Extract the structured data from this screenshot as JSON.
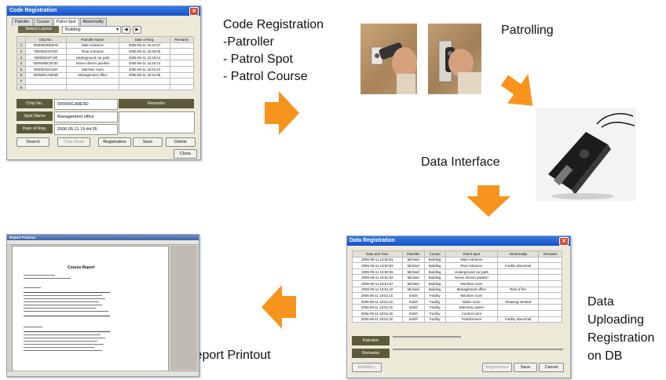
{
  "flow": {
    "step1": {
      "title": "Code Registration",
      "items": [
        "-Patroller",
        "- Patrol Spot",
        "- Patrol Course"
      ]
    },
    "step2": {
      "label": "Patrolling"
    },
    "step3": {
      "label": "Data Interface"
    },
    "step4": {
      "lines": [
        "Data",
        "Uploading",
        "Registration",
        "on DB"
      ]
    },
    "step5": {
      "label": "Report Printout"
    }
  },
  "colors": {
    "arrow": "#f7941d",
    "olive_button": "#5c5a3a",
    "titlebar": "#1f5fd6"
  },
  "code_window": {
    "title": "Code Registration",
    "tabs": [
      "Patroller",
      "Course",
      "Patrol Spot",
      "Abnormality"
    ],
    "select_button": "Select Layout",
    "select_value": "Building",
    "columns": [
      "Chip No.",
      "Patroller Name",
      "Date of Reg.",
      "Remarks"
    ],
    "rows": [
      {
        "n": "1",
        "chip": "0000002DE9A8",
        "name": "Main entrance",
        "date": "2006-05-11 15:44:57"
      },
      {
        "n": "2",
        "chip": "00000024CF50",
        "name": "Rear entrance",
        "date": "2006-05-11 15:45:05"
      },
      {
        "n": "3",
        "chip": "00000024F72E",
        "name": "Underground car park",
        "date": "2006-05-11 15:46:01"
      },
      {
        "n": "4",
        "chip": "000000BC9C0C",
        "name": "Seven drivers pavilion",
        "date": "2006-05-11 15:46:12"
      },
      {
        "n": "5",
        "chip": "00000022A1DF",
        "name": "Machine room",
        "date": "2006-05-11 15:44:24"
      },
      {
        "n": "6",
        "chip": "000000CA8E5D",
        "name": "Management office",
        "date": "2006-05-11 15:44:35"
      },
      {
        "n": "7",
        "chip": "",
        "name": "",
        "date": ""
      },
      {
        "n": "8",
        "chip": "",
        "name": "",
        "date": ""
      }
    ],
    "chip_label": "Chip No.",
    "chip_value": "000000CA8E5D",
    "remarks_label": "Remarks",
    "spot_label": "Spot Name",
    "spot_value": "Management office",
    "date_label": "Date of Reg.",
    "date_value": "2006-05-11 15:44:35",
    "buttons": [
      "Search",
      "Chip Read",
      "Registration",
      "Save",
      "Delete"
    ],
    "close": "Close"
  },
  "data_window": {
    "title": "Data Registration",
    "columns": [
      "Date and Time",
      "Patroller",
      "Course",
      "Patrol Spot",
      "Abnormality",
      "Remarks"
    ],
    "rows": [
      [
        "2006-05-11 19:50:51",
        "Michael",
        "Building",
        "Main entrance",
        "",
        ""
      ],
      [
        "2006-05-11 19:50:53",
        "Michael",
        "Building",
        "Rear entrance",
        "Facility abnormal",
        ""
      ],
      [
        "2006-05-11 19:50:55",
        "Michael",
        "Building",
        "Underground car park",
        "",
        ""
      ],
      [
        "2006-05-11 19:51:02",
        "Michael",
        "Building",
        "Seven drivers pavilion",
        "",
        ""
      ],
      [
        "2006-05-11 19:51:07",
        "Michael",
        "Building",
        "Machine room",
        "",
        ""
      ],
      [
        "2006-05-11 19:51:10",
        "Michael",
        "Building",
        "Management office",
        "Risk of fire",
        ""
      ],
      [
        "2006-05-11 19:51:1C",
        "Smith",
        "Facility",
        "Machine room",
        "",
        ""
      ],
      [
        "2006-05-11 19:51:1C",
        "Smith",
        "Facility",
        "Boiler room",
        "Cleaning needed",
        ""
      ],
      [
        "2006-05-11 19:51:2C",
        "Smith",
        "Facility",
        "Electricity panel",
        "",
        ""
      ],
      [
        "2006-05-11 19:51:3C",
        "Smith",
        "Facility",
        "Control room",
        "",
        ""
      ],
      [
        "2006-05-11 19:51:3C",
        "Smith",
        "Facility",
        "Transformers",
        "Facility abnormal",
        ""
      ]
    ],
    "patroller_label": "Patroller",
    "remarks_label": "Remarks",
    "buttons": [
      "Edit/Reg.",
      "Registration",
      "Save",
      "Cancel"
    ]
  },
  "report_window": {
    "title": "Report Printout",
    "heading": "Course Report"
  }
}
